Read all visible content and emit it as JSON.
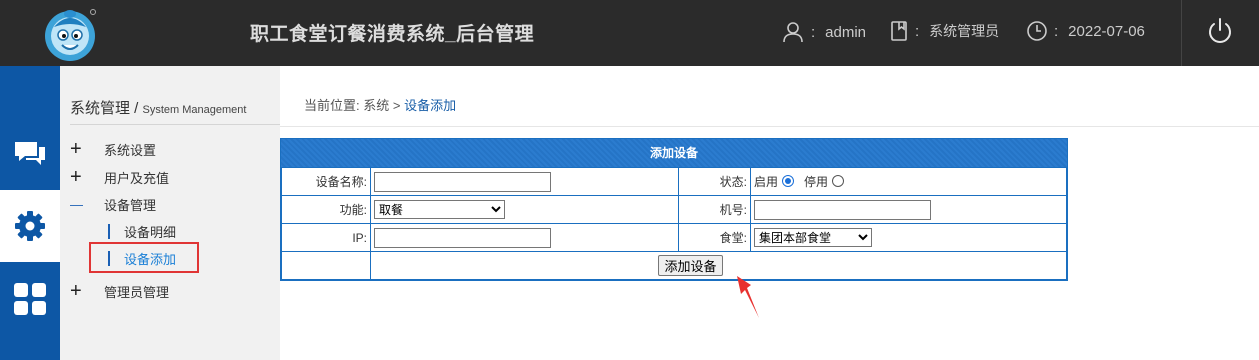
{
  "header": {
    "title": "职工食堂订餐消费系统_后台管理",
    "user": "admin",
    "role": "系统管理员",
    "date": "2022-07-06",
    "separator": ":",
    "icons": [
      "user-icon",
      "book-icon",
      "clock-icon",
      "power-icon"
    ]
  },
  "rail": {
    "items": [
      "chat-icon",
      "gear-icon",
      "grid-icon"
    ],
    "active_index": 1,
    "color": "#0d57a5"
  },
  "sidebar": {
    "title": "系统管理",
    "title_sep": " / ",
    "title_en": "System Management",
    "groups": [
      {
        "label": "系统设置",
        "sign": "+"
      },
      {
        "label": "用户及充值",
        "sign": "+"
      },
      {
        "label": "设备管理",
        "sign": "—"
      },
      {
        "label": "管理员管理",
        "sign": "+"
      }
    ],
    "sub_items": [
      {
        "label": "设备明细"
      },
      {
        "label": "设备添加"
      }
    ]
  },
  "breadcrumb": {
    "prefix": "当前位置:",
    "path": "系统 >",
    "current": "设备添加"
  },
  "form": {
    "header": "添加设备",
    "fields": {
      "name_label": "设备名称:",
      "name_value": "",
      "status_label": "状态:",
      "status_on": "启用",
      "status_off": "停用",
      "function_label": "功能:",
      "function_value": "取餐",
      "machine_label": "机号:",
      "machine_value": "",
      "ip_label": "IP:",
      "ip_value": "",
      "canteen_label": "食堂:",
      "canteen_value": "集团本部食堂"
    },
    "submit": "添加设备"
  },
  "colors": {
    "header_bg": "#2b2b2b",
    "accent": "#1a6fc0",
    "highlight": "#e03535"
  }
}
